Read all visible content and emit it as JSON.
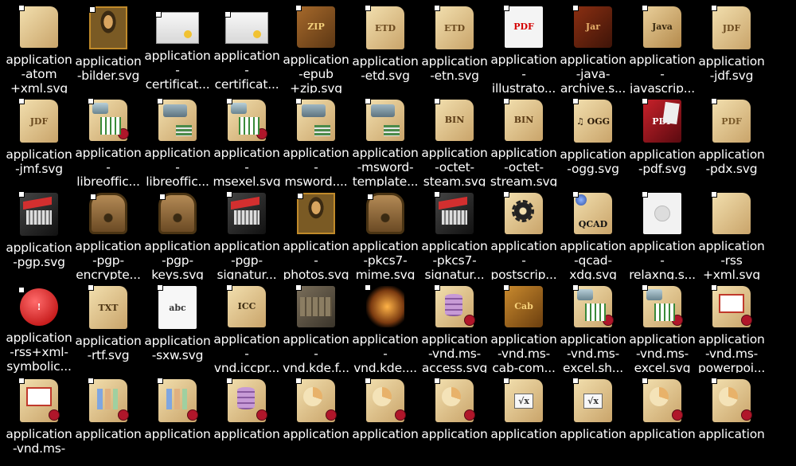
{
  "rows": [
    [
      {
        "label": "application\n-atom\n+xml.svg",
        "icon": "parchment-doc-icon",
        "kind": "parchment",
        "text": ""
      },
      {
        "label": "application\n-bilder.svg",
        "icon": "mona-lisa-picture-icon",
        "kind": "monalisa",
        "text": ""
      },
      {
        "label": "application\n-\ncertificat...",
        "icon": "certificate-icon",
        "kind": "cert",
        "text": ""
      },
      {
        "label": "application\n-\ncertificat...",
        "icon": "certificate-icon",
        "kind": "cert",
        "text": ""
      },
      {
        "label": "application\n-epub\n+zip.svg",
        "icon": "zip-archive-icon",
        "kind": "zip",
        "text": "ZIP"
      },
      {
        "label": "application\n-etd.svg",
        "icon": "etd-document-icon",
        "kind": "parchment",
        "text": "ETD"
      },
      {
        "label": "application\n-etn.svg",
        "icon": "etn-document-icon",
        "kind": "parchment",
        "text": "ETD"
      },
      {
        "label": "application\n-\nillustrato...",
        "icon": "pdf-acrobat-icon",
        "kind": "pdfred",
        "text": "PDF"
      },
      {
        "label": "application\n-java-\narchive.s...",
        "icon": "jar-archive-icon",
        "kind": "jar",
        "text": "Jar"
      },
      {
        "label": "application\n-\njavascrip...",
        "icon": "java-document-icon",
        "kind": "java",
        "text": "Java"
      },
      {
        "label": "application\n-jdf.svg",
        "icon": "jdf-document-icon",
        "kind": "parchment",
        "text": "JDF"
      }
    ],
    [
      {
        "label": "application\n-jmf.svg",
        "icon": "jdf-document-icon",
        "kind": "parchment",
        "text": "JDF"
      },
      {
        "label": "application\n-\nlibreoffic...",
        "icon": "spreadsheet-typewriter-icon",
        "kind": "sheet",
        "text": ""
      },
      {
        "label": "application\n-\nlibreoffic...",
        "icon": "typewriter-document-icon",
        "kind": "typewriter",
        "text": ""
      },
      {
        "label": "application\n-\nmsexel.svg",
        "icon": "spreadsheet-typewriter-icon",
        "kind": "sheet",
        "text": ""
      },
      {
        "label": "application\n-\nmsword....",
        "icon": "typewriter-document-icon",
        "kind": "typewriter",
        "text": ""
      },
      {
        "label": "application\n-msword-\ntemplate...",
        "icon": "typewriter-document-icon",
        "kind": "typewriter",
        "text": ""
      },
      {
        "label": "application\n-octet-\nsteam.svg",
        "icon": "binary-document-icon",
        "kind": "bin",
        "text": "BIN"
      },
      {
        "label": "application\n-octet-\nstream.svg",
        "icon": "binary-document-icon",
        "kind": "bin",
        "text": "BIN"
      },
      {
        "label": "application\n-ogg.svg",
        "icon": "ogg-music-icon",
        "kind": "ogg",
        "text": "♫ OGG"
      },
      {
        "label": "application\n-pdf.svg",
        "icon": "pdf-book-icon",
        "kind": "pdfbook",
        "text": "PDF"
      },
      {
        "label": "application\n-pdx.svg",
        "icon": "pdx-document-icon",
        "kind": "pdx",
        "text": "PDF"
      }
    ],
    [
      {
        "label": "application\n-pgp.svg",
        "icon": "keyring-icon",
        "kind": "keyring",
        "text": ""
      },
      {
        "label": "application\n-pgp-\nencrypte...",
        "icon": "padlock-icon",
        "kind": "lock",
        "text": ""
      },
      {
        "label": "application\n-pgp-\nkeys.svg",
        "icon": "padlock-icon",
        "kind": "lock",
        "text": ""
      },
      {
        "label": "application\n-pgp-\nsignatur...",
        "icon": "keyring-icon",
        "kind": "keyring",
        "text": ""
      },
      {
        "label": "application\n-\nphotos.svg",
        "icon": "mona-lisa-picture-icon",
        "kind": "monalisa",
        "text": ""
      },
      {
        "label": "application\n-pkcs7-\nmime.svg",
        "icon": "padlock-icon",
        "kind": "lock",
        "text": ""
      },
      {
        "label": "application\n-pkcs7-\nsignatur...",
        "icon": "keyring-icon",
        "kind": "keyring",
        "text": ""
      },
      {
        "label": "application\n-\npostscrip...",
        "icon": "gear-document-icon",
        "kind": "gear",
        "text": ""
      },
      {
        "label": "application\n-qcad-\nxdg.svg",
        "icon": "qcad-document-icon",
        "kind": "qcad",
        "text": "QCAD"
      },
      {
        "label": "application\n-\nrelaxng.s...",
        "icon": "relaxng-document-icon",
        "kind": "relaxng",
        "text": ""
      },
      {
        "label": "application\n-rss\n+xml.svg",
        "icon": "parchment-doc-icon",
        "kind": "docs",
        "text": ""
      }
    ],
    [
      {
        "label": "application\n-rss+xml-\nsymbolic...",
        "icon": "exclamation-icon",
        "kind": "exclaim",
        "text": "!"
      },
      {
        "label": "application\n-rtf.svg",
        "icon": "txt-document-icon",
        "kind": "txt",
        "text": "TXT"
      },
      {
        "label": "application\n-sxw.svg",
        "icon": "sxw-document-icon",
        "kind": "sxw",
        "text": "abc"
      },
      {
        "label": "application\n-\nvnd.iccpr...",
        "icon": "icc-document-icon",
        "kind": "icc",
        "text": "ICC"
      },
      {
        "label": "application\n-\nvnd.kde.f...",
        "icon": "crate-icon",
        "kind": "crate",
        "text": ""
      },
      {
        "label": "application\n-\nvnd.kde....",
        "icon": "treasure-chest-icon",
        "kind": "chest",
        "text": ""
      },
      {
        "label": "application\n-vnd.ms-\naccess.svg",
        "icon": "database-document-icon",
        "kind": "db",
        "text": ""
      },
      {
        "label": "application\n-vnd.ms-\ncab-com...",
        "icon": "cab-archive-icon",
        "kind": "cab",
        "text": "Cab"
      },
      {
        "label": "application\n-vnd.ms-\nexcel.sh...",
        "icon": "spreadsheet-document-icon",
        "kind": "sheet",
        "text": ""
      },
      {
        "label": "application\n-vnd.ms-\nexcel.svg",
        "icon": "spreadsheet-document-icon",
        "kind": "sheet",
        "text": ""
      },
      {
        "label": "application\n-vnd.ms-\npowerpoi...",
        "icon": "presentation-document-icon",
        "kind": "present",
        "text": ""
      }
    ],
    [
      {
        "label": "application\n-vnd.ms-",
        "icon": "presentation-document-icon",
        "kind": "present",
        "text": ""
      },
      {
        "label": "application",
        "icon": "chart-document-icon",
        "kind": "chartdoc",
        "text": ""
      },
      {
        "label": "application",
        "icon": "chart-document-icon",
        "kind": "chartdoc",
        "text": ""
      },
      {
        "label": "application",
        "icon": "database-document-icon",
        "kind": "db",
        "text": ""
      },
      {
        "label": "application",
        "icon": "pie-chart-document-icon",
        "kind": "pie",
        "text": ""
      },
      {
        "label": "application",
        "icon": "pie-chart-document-icon",
        "kind": "pie",
        "text": ""
      },
      {
        "label": "application",
        "icon": "pie-chart-document-icon",
        "kind": "pie",
        "text": ""
      },
      {
        "label": "application",
        "icon": "formula-document-icon",
        "kind": "formula",
        "text": "√x"
      },
      {
        "label": "application",
        "icon": "formula-document-icon",
        "kind": "formula",
        "text": "√x"
      },
      {
        "label": "application",
        "icon": "pie-chart-document-icon",
        "kind": "pie",
        "text": ""
      },
      {
        "label": "application",
        "icon": "pie-chart-document-icon",
        "kind": "pie",
        "text": ""
      }
    ]
  ]
}
